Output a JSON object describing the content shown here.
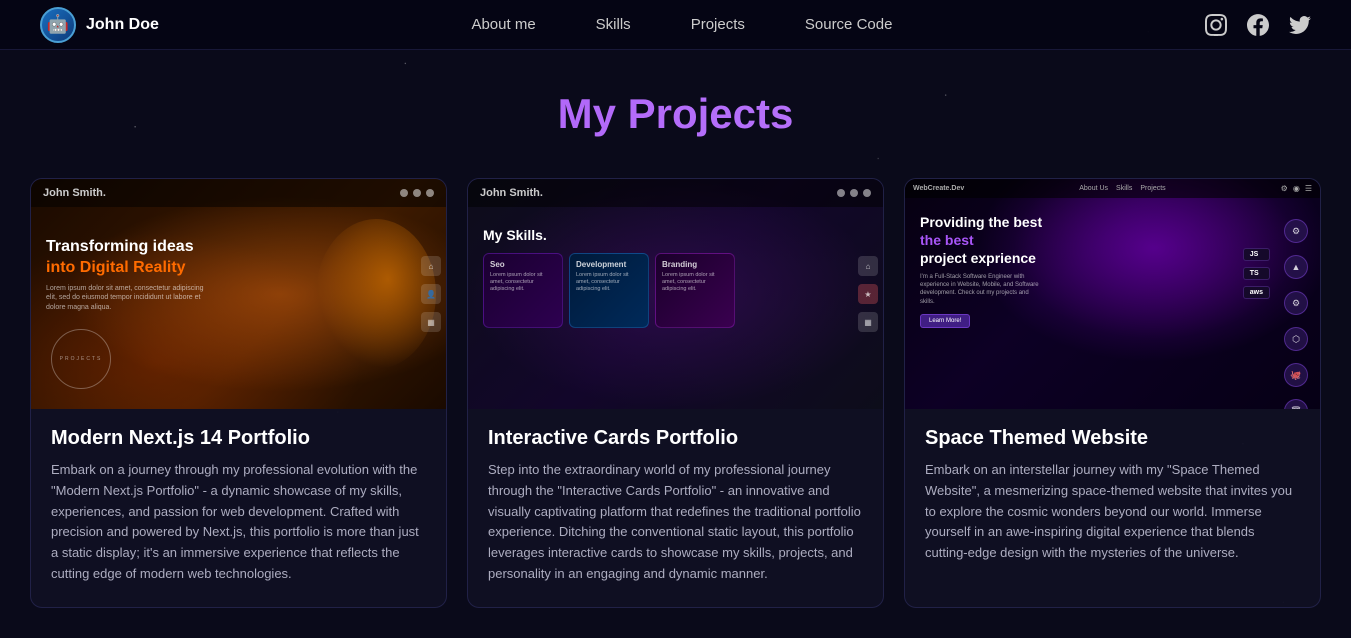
{
  "nav": {
    "brand": {
      "name": "John Doe",
      "logo_symbol": "🤖"
    },
    "links": [
      {
        "id": "about",
        "label": "About me",
        "href": "#"
      },
      {
        "id": "skills",
        "label": "Skills",
        "href": "#"
      },
      {
        "id": "projects",
        "label": "Projects",
        "href": "#"
      },
      {
        "id": "source",
        "label": "Source Code",
        "href": "#"
      }
    ]
  },
  "page_title": "My Projects",
  "projects": [
    {
      "id": "project-1",
      "title": "Modern Next.js 14 Portfolio",
      "description": "Embark on a journey through my professional evolution with the \"Modern Next.js Portfolio\" - a dynamic showcase of my skills, experiences, and passion for web development. Crafted with precision and powered by Next.js, this portfolio is more than just a static display; it's an immersive experience that reflects the cutting edge of modern web technologies.",
      "thumb_name": "John Smith.",
      "thumb_hero_line1": "Transforming ideas",
      "thumb_hero_line2": "into Digital Reality",
      "thumb_hero_desc": "Lorem ipsum dolor sit amet, consectetur adipiscing elit, sed do eiusmod tempor incididunt ut labore et dolore magna aliqua.",
      "thumb_projects_label": "PROJECTS"
    },
    {
      "id": "project-2",
      "title": "Interactive Cards Portfolio",
      "description": "Step into the extraordinary world of my professional journey through the \"Interactive Cards Portfolio\" - an innovative and visually captivating platform that redefines the traditional portfolio experience. Ditching the conventional static layout, this portfolio leverages interactive cards to showcase my skills, projects, and personality in an engaging and dynamic manner.",
      "thumb_name": "John Smith.",
      "thumb_skills_title": "My Skills.",
      "thumb_skills": [
        {
          "label": "Seo",
          "text": "Lorem ipsum dolor sit amet, consectetur adipiscing elit."
        },
        {
          "label": "Development",
          "text": "Lorem ipsum dolor sit amet, consectetur adipiscing elit."
        },
        {
          "label": "Branding",
          "text": "Lorem ipsum dolor sit amet, consectetur adipiscing elit."
        }
      ]
    },
    {
      "id": "project-3",
      "title": "Space Themed Website",
      "description": "Embark on an interstellar journey with my \"Space Themed Website\", a mesmerizing space-themed website that invites you to explore the cosmic wonders beyond our world. Immerse yourself in an awe-inspiring digital experience that blends cutting-edge design with the mysteries of the universe.",
      "thumb_name": "WebCreate.Dev",
      "thumb_nav_links": [
        "About Us",
        "Skills",
        "Projects"
      ],
      "thumb_hero_line1": "Providing the best",
      "thumb_hero_line2": "project exprience",
      "thumb_hero_desc": "I'm a Full-Stack Software Engineer with experience in Website, Mobile, and Software development. Check out my projects and skills.",
      "thumb_cta": "Learn More!",
      "thumb_tech": [
        "JS",
        "TS",
        "aws"
      ]
    }
  ],
  "social": {
    "instagram_label": "instagram",
    "facebook_label": "facebook",
    "twitter_label": "twitter"
  }
}
